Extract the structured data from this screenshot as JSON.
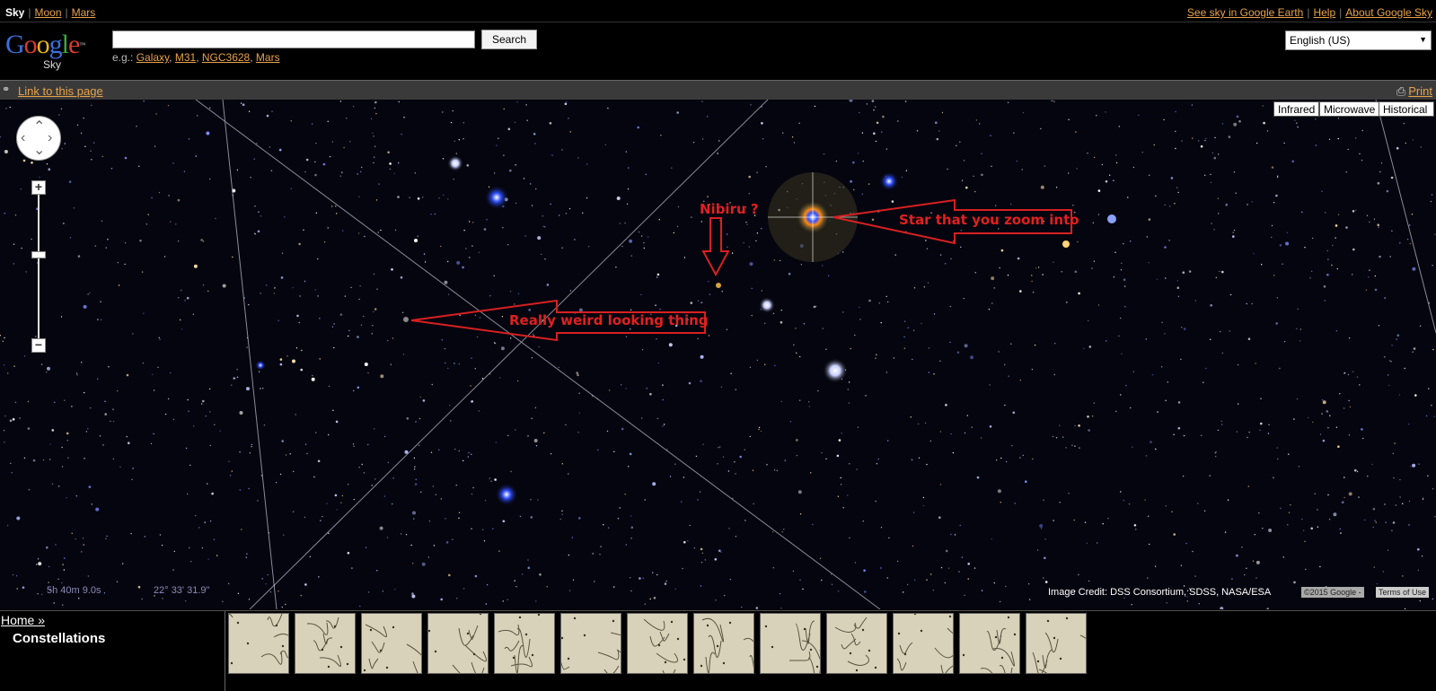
{
  "topnav": {
    "sky": "Sky",
    "moon": "Moon",
    "mars": "Mars",
    "google_earth": "See sky in Google Earth",
    "help": "Help",
    "about": "About Google Sky"
  },
  "header": {
    "logo_word": "Google",
    "logo_sub": "Sky",
    "search_value": "",
    "search_button": "Search",
    "examples_prefix": "e.g.:",
    "examples": [
      "Galaxy",
      "M31",
      "NGC3628",
      "Mars"
    ],
    "language": "English (US)"
  },
  "linkbar": {
    "link": "Link to this page",
    "print": "Print"
  },
  "map": {
    "types": [
      "Infrared",
      "Microwave",
      "Historical"
    ],
    "ra": "5h 40m 9.0s",
    "dec": "22° 33' 31.9\"",
    "credit": "Image Credit: DSS Consortium, SDSS, NASA/ESA",
    "copyright": "©2015 Google -",
    "terms": "Terms of Use",
    "annotations": {
      "nibiru": "Nibiru ?",
      "star": "Star that you zoom into",
      "weird": "Really weird looking thing"
    }
  },
  "bottom": {
    "home": "Home »",
    "title": "Constellations",
    "thumbnail_count": 13
  },
  "colors": {
    "link": "#e8a24a",
    "annotation": "#e02020",
    "sky": "#05050f",
    "bar": "#3a3a3a"
  }
}
